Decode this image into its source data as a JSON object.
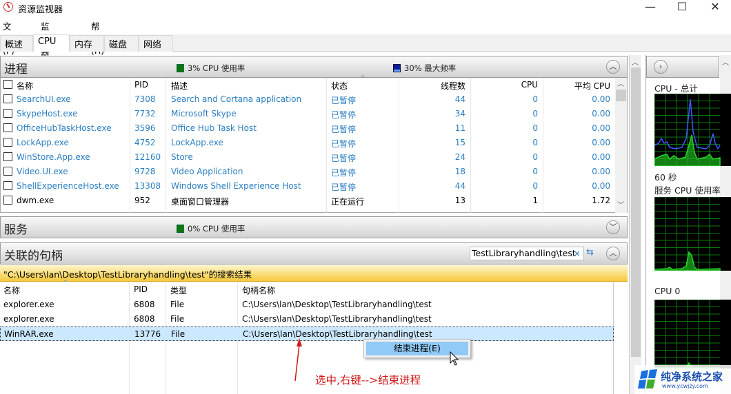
{
  "window": {
    "title": "资源监视器",
    "minimize": "—",
    "maximize": "☐",
    "close": "✕"
  },
  "menu": [
    "文件(F)",
    "监视器(M)",
    "帮助(H)"
  ],
  "tabs": [
    {
      "label": "概述",
      "active": false
    },
    {
      "label": "CPU",
      "active": true
    },
    {
      "label": "内存",
      "active": false
    },
    {
      "label": "磁盘",
      "active": false
    },
    {
      "label": "网络",
      "active": false
    }
  ],
  "processes": {
    "title": "进程",
    "cpu_usage": "3% CPU 使用率",
    "max_freq": "30% 最大频率",
    "columns": [
      "名称",
      "PID",
      "描述",
      "状态",
      "线程数",
      "CPU",
      "平均 CPU"
    ],
    "rows": [
      {
        "name": "SearchUI.exe",
        "pid": "7308",
        "desc": "Search and Cortana application",
        "status": "已暂停",
        "threads": "44",
        "cpu": "0",
        "avg": "0.00",
        "suspended": true
      },
      {
        "name": "SkypeHost.exe",
        "pid": "7732",
        "desc": "Microsoft Skype",
        "status": "已暂停",
        "threads": "34",
        "cpu": "0",
        "avg": "0.00",
        "suspended": true
      },
      {
        "name": "OfficeHubTaskHost.exe",
        "pid": "3596",
        "desc": "Office Hub Task Host",
        "status": "已暂停",
        "threads": "11",
        "cpu": "0",
        "avg": "0.00",
        "suspended": true
      },
      {
        "name": "LockApp.exe",
        "pid": "4752",
        "desc": "LockApp.exe",
        "status": "已暂停",
        "threads": "15",
        "cpu": "0",
        "avg": "0.00",
        "suspended": true
      },
      {
        "name": "WinStore.App.exe",
        "pid": "12160",
        "desc": "Store",
        "status": "已暂停",
        "threads": "24",
        "cpu": "0",
        "avg": "0.00",
        "suspended": true
      },
      {
        "name": "Video.UI.exe",
        "pid": "9728",
        "desc": "Video Application",
        "status": "已暂停",
        "threads": "18",
        "cpu": "0",
        "avg": "0.00",
        "suspended": true
      },
      {
        "name": "ShellExperienceHost.exe",
        "pid": "13308",
        "desc": "Windows Shell Experience Host",
        "status": "已暂停",
        "threads": "44",
        "cpu": "0",
        "avg": "0.00",
        "suspended": true
      },
      {
        "name": "dwm.exe",
        "pid": "952",
        "desc": "桌面窗口管理器",
        "status": "正在运行",
        "threads": "13",
        "cpu": "1",
        "avg": "1.72",
        "suspended": false
      }
    ]
  },
  "services": {
    "title": "服务",
    "cpu_usage": "0% CPU 使用率"
  },
  "handles": {
    "title": "关联的句柄",
    "search_value": "TestLibraryhandling\\test",
    "clear_icon": "×",
    "results_banner": "\"C:\\Users\\lan\\Desktop\\TestLibraryhandling\\test\"的搜索结果",
    "columns": [
      "名称",
      "PID",
      "类型",
      "句柄名称"
    ],
    "rows": [
      {
        "name": "explorer.exe",
        "pid": "6808",
        "type": "File",
        "handle": "C:\\Users\\lan\\Desktop\\TestLibraryhandling\\test"
      },
      {
        "name": "explorer.exe",
        "pid": "6808",
        "type": "File",
        "handle": "C:\\Users\\lan\\Desktop\\TestLibraryhandling\\test"
      },
      {
        "name": "WinRAR.exe",
        "pid": "13776",
        "type": "File",
        "handle": "C:\\Users\\lan\\Desktop\\TestLibraryhandling\\test",
        "selected": true
      }
    ]
  },
  "context_menu": {
    "items": [
      "结束进程(E)"
    ]
  },
  "annotation": "选中,右键-->结束进程",
  "right_panel": {
    "graphs": [
      {
        "label": "CPU - 总计",
        "footer": "60 秒"
      },
      {
        "label": "服务 CPU 使用率"
      },
      {
        "label": "CPU 0"
      }
    ]
  },
  "watermark": {
    "title": "纯净系统之家",
    "url": "www.ycwjzy.com"
  },
  "colors": {
    "link_blue": "#2a7ec0",
    "banner_yellow": "#f5c93a",
    "selection": "#cce8ff",
    "annotation_red": "#d01818",
    "graph_green": "#22cc22",
    "graph_blue": "#3a5cff"
  }
}
